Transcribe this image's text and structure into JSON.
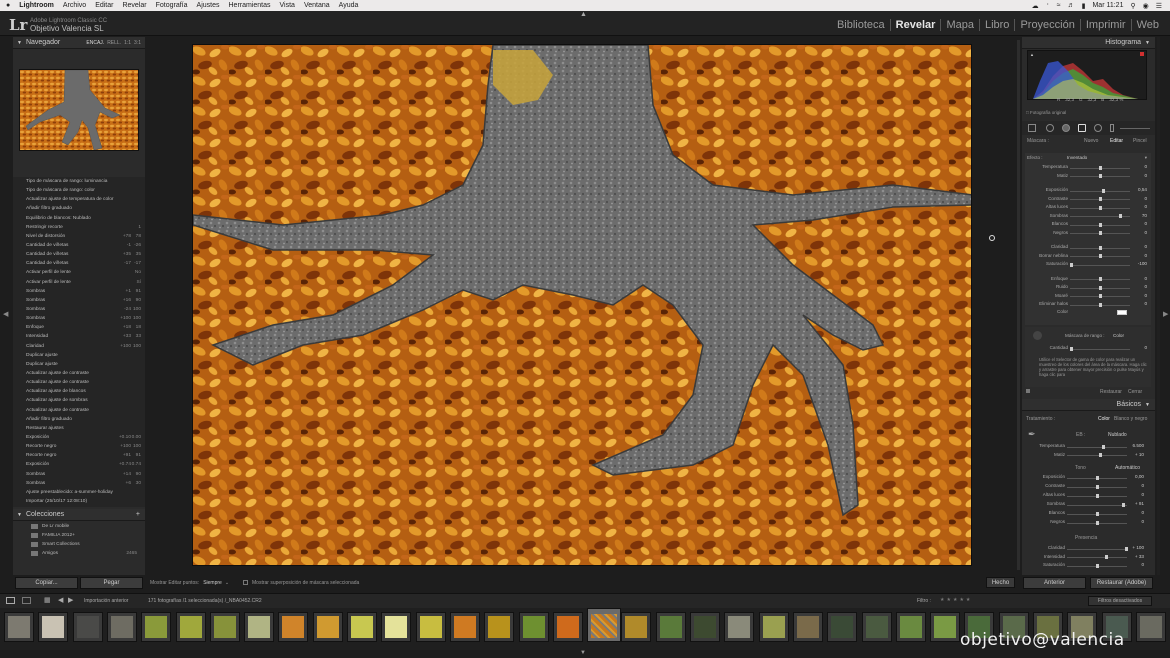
{
  "menubar": {
    "app": "Lightroom",
    "items": [
      "Archivo",
      "Editar",
      "Revelar",
      "Fotografía",
      "Ajustes",
      "Herramientas",
      "Vista",
      "Ventana",
      "Ayuda"
    ],
    "clock": "Mar 11:21"
  },
  "header": {
    "logo": "Lr",
    "product": "Adobe Lightroom Classic CC",
    "catalog": "Objetivo Valencia SL",
    "modules": [
      "Biblioteca",
      "Revelar",
      "Mapa",
      "Libro",
      "Proyección",
      "Imprimir",
      "Web"
    ],
    "active_module": "Revelar"
  },
  "left": {
    "navigator_title": "Navegador",
    "nav_options": [
      "ENCAJ.",
      "RELL.",
      "1:1",
      "3:1"
    ],
    "history": [
      {
        "label": "Tipo de máscara de rango: luminancia",
        "v1": "",
        "v2": ""
      },
      {
        "label": "Tipo de máscara de rango: color",
        "v1": "",
        "v2": ""
      },
      {
        "label": "Actualizar ajuste de temperatura de color",
        "v1": "",
        "v2": ""
      },
      {
        "label": "Añadir filtro graduado",
        "v1": "",
        "v2": ""
      },
      {
        "label": "Equilibrio de blancos: Nublado",
        "v1": "",
        "v2": ""
      },
      {
        "label": "Restringir recorte",
        "v1": "",
        "v2": "1"
      },
      {
        "label": "Nivel de distorsión",
        "v1": "+78",
        "v2": "78"
      },
      {
        "label": "Cantidad de viñetas",
        "v1": "-1",
        "v2": "-26"
      },
      {
        "label": "Cantidad de viñetas",
        "v1": "+35",
        "v2": "35"
      },
      {
        "label": "Cantidad de viñetas",
        "v1": "-17",
        "v2": "-17"
      },
      {
        "label": "Activar perfil de lente",
        "v1": "",
        "v2": "No"
      },
      {
        "label": "Activar perfil de lente",
        "v1": "",
        "v2": "Sí"
      },
      {
        "label": "Sombras",
        "v1": "+1",
        "v2": "91"
      },
      {
        "label": "Sombras",
        "v1": "+16",
        "v2": "90"
      },
      {
        "label": "Sombras",
        "v1": "-24",
        "v2": "100"
      },
      {
        "label": "Sombras",
        "v1": "+100",
        "v2": "100"
      },
      {
        "label": "Enfoque",
        "v1": "+18",
        "v2": "18"
      },
      {
        "label": "Intensidad",
        "v1": "+33",
        "v2": "33"
      },
      {
        "label": "Claridad",
        "v1": "+100",
        "v2": "100"
      },
      {
        "label": "Duplicar ajuste",
        "v1": "",
        "v2": ""
      },
      {
        "label": "Duplicar ajuste",
        "v1": "",
        "v2": ""
      },
      {
        "label": "Actualizar ajuste de contraste",
        "v1": "",
        "v2": ""
      },
      {
        "label": "Actualizar ajuste de contraste",
        "v1": "",
        "v2": ""
      },
      {
        "label": "Actualizar ajuste de blancos",
        "v1": "",
        "v2": ""
      },
      {
        "label": "Actualizar ajuste de sombras",
        "v1": "",
        "v2": ""
      },
      {
        "label": "Actualizar ajuste de contraste",
        "v1": "",
        "v2": ""
      },
      {
        "label": "Añadir filtro graduado",
        "v1": "",
        "v2": ""
      },
      {
        "label": "Restaurar ajustes",
        "v1": "",
        "v2": ""
      },
      {
        "label": "Exposición",
        "v1": "+0.10",
        "v2": "0.00"
      },
      {
        "label": "Recorte negro",
        "v1": "+100",
        "v2": "100"
      },
      {
        "label": "Recorte negro",
        "v1": "+91",
        "v2": "91"
      },
      {
        "label": "Exposición",
        "v1": "+0.74",
        "v2": "0.74"
      },
      {
        "label": "Sombras",
        "v1": "+14",
        "v2": "90"
      },
      {
        "label": "Sombras",
        "v1": "+6",
        "v2": "30"
      },
      {
        "label": "Ajuste preestablecido: a-summer-holiday",
        "v1": "",
        "v2": ""
      },
      {
        "label": "Importar (25/10/17 12:08:10)",
        "v1": "",
        "v2": ""
      }
    ],
    "collections_title": "Colecciones",
    "collections": [
      {
        "label": "De Lr mobile",
        "count": ""
      },
      {
        "label": "FAMILIA 2012+",
        "count": ""
      },
      {
        "label": "Smart Collections",
        "count": ""
      },
      {
        "label": "Amigos",
        "count": "2465"
      }
    ],
    "copy_label": "Copiar...",
    "paste_label": "Pegar"
  },
  "toolbar": {
    "show_points_label": "Mostrar Editar puntos:",
    "show_points_value": "Siempre",
    "mask_overlay_label": "Mostrar superposición de máscara seleccionada",
    "done_label": "Hecho"
  },
  "right": {
    "histogram_title": "Histograma",
    "histo_values": [
      "R",
      "32,3",
      "G",
      "32,3",
      "B",
      "32,3 %"
    ],
    "original_label": "Fotografía original",
    "mask_tabs": [
      "Máscara :",
      "Nuevo",
      "Editar",
      "Pincel"
    ],
    "effect_label": "Efecto :",
    "effect_value": "Inventado",
    "sliders": [
      {
        "label": "Temperatura",
        "val": "0",
        "pos": 0.5
      },
      {
        "label": "Matiz",
        "val": "0",
        "pos": 0.5
      },
      {
        "label": "Exposición",
        "val": "0,54",
        "pos": 0.56
      },
      {
        "label": "Contraste",
        "val": "0",
        "pos": 0.5
      },
      {
        "label": "Altas luces",
        "val": "0",
        "pos": 0.5
      },
      {
        "label": "Sombras",
        "val": "70",
        "pos": 0.85
      },
      {
        "label": "Blancos",
        "val": "0",
        "pos": 0.5
      },
      {
        "label": "Negros",
        "val": "0",
        "pos": 0.5
      },
      {
        "label": "Claridad",
        "val": "0",
        "pos": 0.5
      },
      {
        "label": "Borrar neblina",
        "val": "0",
        "pos": 0.5
      },
      {
        "label": "Saturación",
        "val": "-100",
        "pos": 0.0
      },
      {
        "label": "Enfoque",
        "val": "0",
        "pos": 0.5
      },
      {
        "label": "Ruido",
        "val": "0",
        "pos": 0.5
      },
      {
        "label": "Moaré",
        "val": "0",
        "pos": 0.5
      },
      {
        "label": "Eliminar halos",
        "val": "0",
        "pos": 0.5
      }
    ],
    "color_label": "Color",
    "range_mask_label": "Máscara de rango :",
    "range_mask_value": "Color",
    "amount_label": "Cantidad",
    "amount_value": "0",
    "range_help": "Utilice el Selector de gama de color para realizar un muestreo de los colores del área de la máscara. Haga clic y arrastre para obtener mayor precisión o pulse Mayús y haga clic para",
    "reset_label": "Restaurar",
    "close_label": "Cerrar",
    "basic_title": "Básicos",
    "treatment_label": "Tratamiento :",
    "treatment_options": [
      "Color",
      "Blanco y negro"
    ],
    "wb_label": "EB :",
    "wb_value": "Nublado",
    "basic_sliders": [
      {
        "label": "Temperatura",
        "val": "6.500",
        "pos": 0.6
      },
      {
        "label": "Matiz",
        "val": "+ 10",
        "pos": 0.55
      }
    ],
    "tone_label": "Tono",
    "auto_label": "Automático",
    "tone_sliders": [
      {
        "label": "Exposición",
        "val": "0,00",
        "pos": 0.5
      },
      {
        "label": "Contraste",
        "val": "0",
        "pos": 0.5
      },
      {
        "label": "Altas luces",
        "val": "0",
        "pos": 0.5
      },
      {
        "label": "Sombras",
        "val": "+ 91",
        "pos": 0.95
      },
      {
        "label": "Blancos",
        "val": "0",
        "pos": 0.5
      },
      {
        "label": "Negros",
        "val": "0",
        "pos": 0.5
      }
    ],
    "presence_label": "Presencia",
    "presence_sliders": [
      {
        "label": "Claridad",
        "val": "+ 100",
        "pos": 1.0
      },
      {
        "label": "Intensidad",
        "val": "+ 33",
        "pos": 0.66
      },
      {
        "label": "Saturación",
        "val": "0",
        "pos": 0.5
      }
    ],
    "prev_label": "Anterior",
    "reset_adobe_label": "Restaurar (Adobe)"
  },
  "filmstrip": {
    "source_label": "Importación anterior",
    "count_label": "171 fotografías /1 seleccionada(s) /_NBA0452.CR2",
    "filter_label": "Filtro :",
    "filter_value": "Filtros desactivados"
  },
  "watermark": "objetivo@valencia",
  "colors": {
    "panel": "#2b2b2b",
    "accent": "#e6e6e6",
    "leaves": "#d4811f"
  }
}
